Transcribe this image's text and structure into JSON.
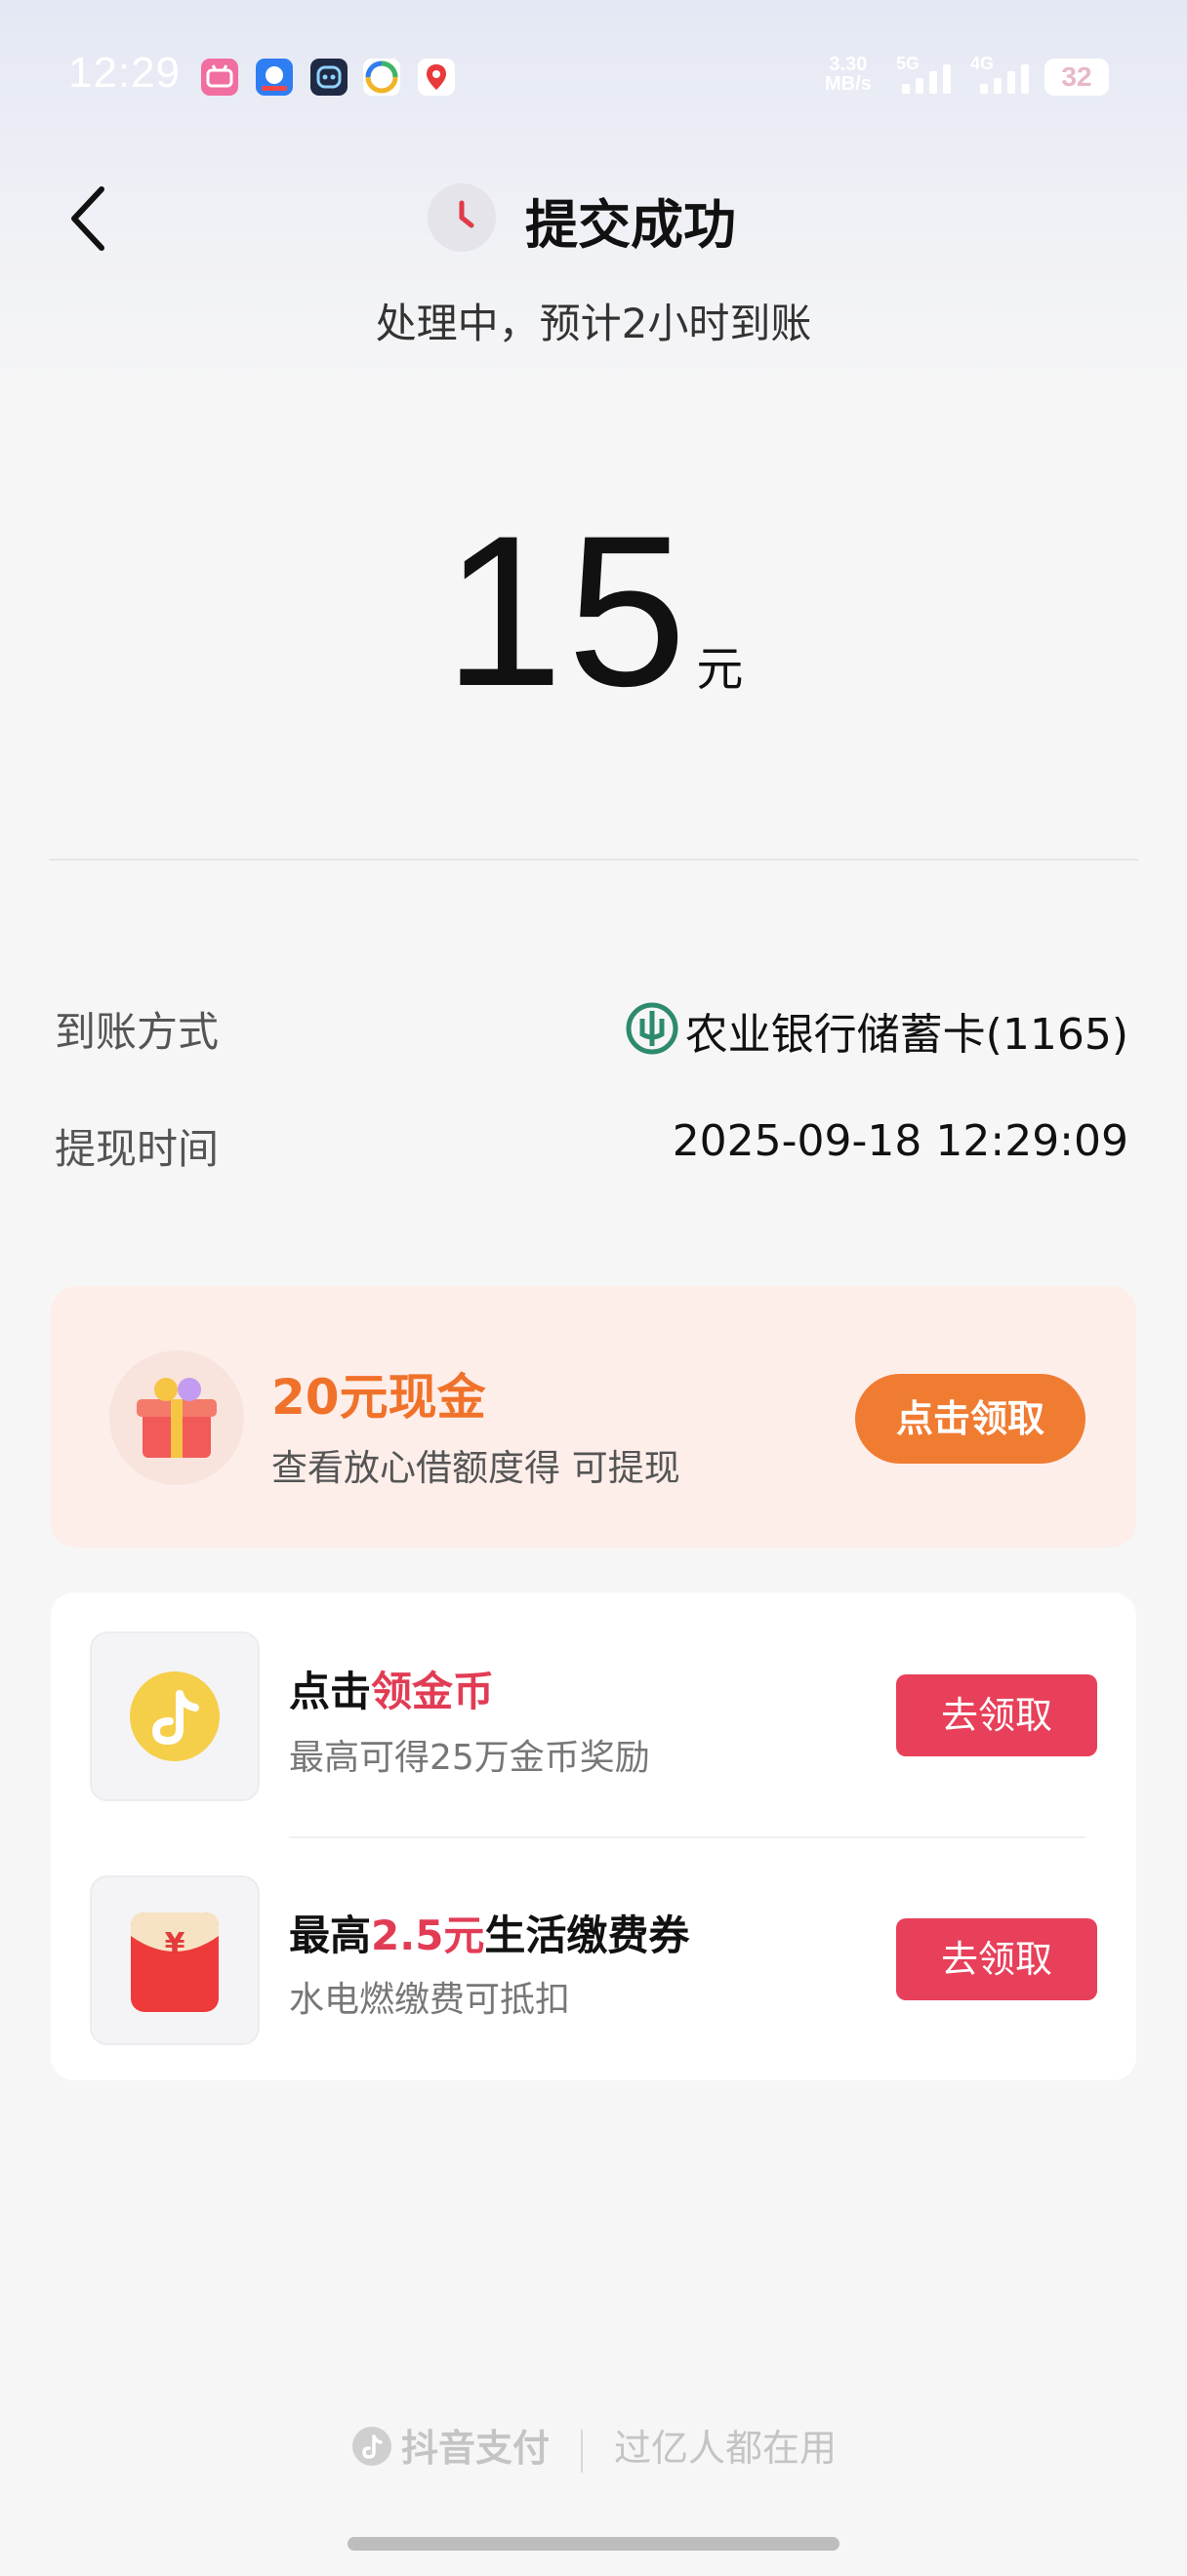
{
  "status_bar": {
    "time": "12:29",
    "net_speed_value": "3.30",
    "net_speed_unit": "MB/s",
    "signal_1": "5G",
    "signal_2": "4G",
    "battery": "32",
    "app_icons": [
      "bilibili-icon",
      "haluo-icon",
      "robot-app-icon",
      "colorful-app-icon",
      "map-pin-app-icon"
    ]
  },
  "header": {
    "title": "提交成功",
    "subtitle": "处理中，预计2小时到账"
  },
  "amount": {
    "value": "15",
    "unit": "元"
  },
  "details": {
    "method_label": "到账方式",
    "method_value": "农业银行储蓄卡(1165)",
    "time_label": "提现时间",
    "time_value": "2025-09-18 12:29:09"
  },
  "promo": {
    "title": "20元现金",
    "subtitle": "查看放心借额度得 可提现",
    "button": "点击领取"
  },
  "tasks": [
    {
      "title_prefix": "点击",
      "title_highlight": "领金币",
      "title_suffix": "",
      "subtitle": "最高可得25万金币奖励",
      "button": "去领取"
    },
    {
      "title_prefix": "最高",
      "title_highlight": "2.5元",
      "title_suffix": "生活缴费券",
      "subtitle": "水电燃缴费可抵扣",
      "button": "去领取"
    }
  ],
  "footer": {
    "brand": "抖音支付",
    "slogan": "过亿人都在用"
  },
  "colors": {
    "accent_red": "#e8405a",
    "accent_orange": "#f07c32",
    "bank_green": "#2e8a6e"
  }
}
